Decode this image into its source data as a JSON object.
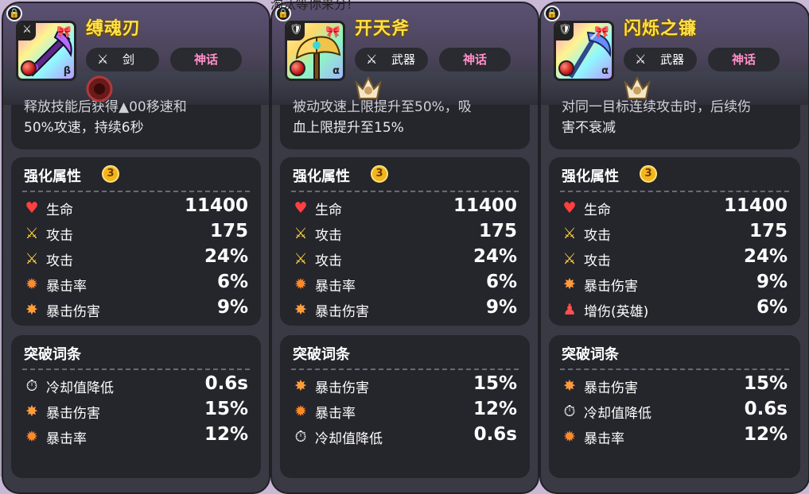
{
  "top_note": "淘汰等你来分!",
  "cards": [
    {
      "name": "缚魂刃",
      "type_label": "剑",
      "type_icon": "sword-icon",
      "rarity": "神话",
      "greek": "β",
      "skill_line1": "释放技能后获得▲00移速和",
      "skill_line2": "50%攻速，持续6秒",
      "enhance_title": "强化属性",
      "enhance_level": "3",
      "enhance": [
        {
          "icon": "heart-icon",
          "label": "生命",
          "value": "11400"
        },
        {
          "icon": "sword-icon",
          "label": "攻击",
          "value": "175"
        },
        {
          "icon": "sword-icon",
          "label": "攻击",
          "value": "24%"
        },
        {
          "icon": "fire-icon",
          "label": "暴击率",
          "value": "6%"
        },
        {
          "icon": "burst-icon",
          "label": "暴击伤害",
          "value": "9%"
        }
      ],
      "break_title": "突破词条",
      "breaks": [
        {
          "icon": "cooldown-icon",
          "label": "冷却值降低",
          "value": "0.6s"
        },
        {
          "icon": "burst-icon",
          "label": "暴击伤害",
          "value": "15%"
        },
        {
          "icon": "fire-icon",
          "label": "暴击率",
          "value": "12%"
        }
      ]
    },
    {
      "name": "开天斧",
      "type_label": "武器",
      "type_icon": "crossed-swords-icon",
      "rarity": "神话",
      "greek": "α",
      "skill_line1": "被动攻速上限提升至50%，吸",
      "skill_line2": "血上限提升至15%",
      "enhance_title": "强化属性",
      "enhance_level": "3",
      "enhance": [
        {
          "icon": "heart-icon",
          "label": "生命",
          "value": "11400"
        },
        {
          "icon": "sword-icon",
          "label": "攻击",
          "value": "175"
        },
        {
          "icon": "sword-icon",
          "label": "攻击",
          "value": "24%"
        },
        {
          "icon": "fire-icon",
          "label": "暴击率",
          "value": "6%"
        },
        {
          "icon": "burst-icon",
          "label": "暴击伤害",
          "value": "9%"
        }
      ],
      "break_title": "突破词条",
      "breaks": [
        {
          "icon": "burst-icon",
          "label": "暴击伤害",
          "value": "15%"
        },
        {
          "icon": "fire-icon",
          "label": "暴击率",
          "value": "12%"
        },
        {
          "icon": "cooldown-icon",
          "label": "冷却值降低",
          "value": "0.6s"
        }
      ]
    },
    {
      "name": "闪烁之镰",
      "type_label": "武器",
      "type_icon": "crossed-swords-icon",
      "rarity": "神话",
      "greek": "α",
      "skill_line1": "对同一目标连续攻击时，后续伤",
      "skill_line2": "害不衰减",
      "enhance_title": "强化属性",
      "enhance_level": "3",
      "enhance": [
        {
          "icon": "heart-icon",
          "label": "生命",
          "value": "11400"
        },
        {
          "icon": "sword-icon",
          "label": "攻击",
          "value": "175"
        },
        {
          "icon": "sword-icon",
          "label": "攻击",
          "value": "24%"
        },
        {
          "icon": "burst-icon",
          "label": "暴击伤害",
          "value": "9%"
        },
        {
          "icon": "person-icon",
          "label": "增伤(英雄)",
          "value": "6%"
        }
      ],
      "break_title": "突破词条",
      "breaks": [
        {
          "icon": "burst-icon",
          "label": "暴击伤害",
          "value": "15%"
        },
        {
          "icon": "cooldown-icon",
          "label": "冷却值降低",
          "value": "0.6s"
        },
        {
          "icon": "fire-icon",
          "label": "暴击率",
          "value": "12%"
        }
      ]
    }
  ]
}
